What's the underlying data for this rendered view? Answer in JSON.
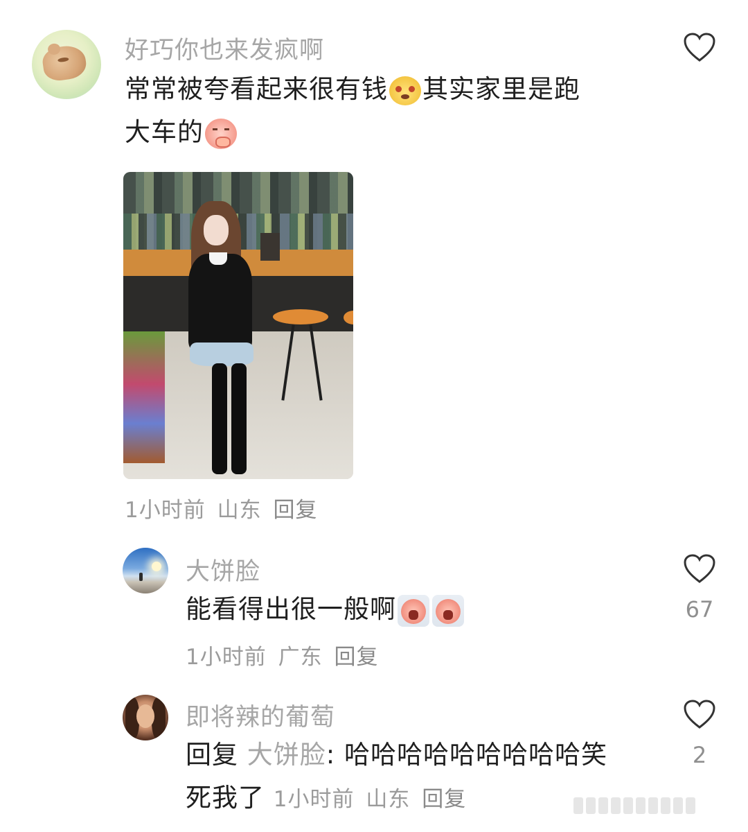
{
  "comment": {
    "username": "好巧你也来发疯啊",
    "text_line1_a": "常常被夸看起来很有钱",
    "text_line1_b": "其实家里是跑",
    "text_line2": "大车的",
    "emoji_1": "dog-face-emoji",
    "emoji_2": "sweet-face-emoji",
    "time": "1小时前",
    "location": "山东",
    "reply_label": "回复"
  },
  "replies": [
    {
      "username": "大饼脸",
      "text": "能看得出很一般啊",
      "emojis": [
        "crying-face-emoji",
        "crying-face-emoji"
      ],
      "time": "1小时前",
      "location": "广东",
      "reply_label": "回复",
      "likes": "67"
    },
    {
      "username": "即将辣的葡萄",
      "reply_prefix": "回复",
      "reply_to": "大饼脸",
      "text_a": ": 哈哈哈哈哈哈哈哈哈笑",
      "text_b": "死我了",
      "time": "1小时前",
      "location": "山东",
      "reply_label": "回复",
      "likes": "2"
    }
  ],
  "icons": {
    "like": "heart-outline-icon"
  },
  "colors": {
    "username": "#a6a6a6",
    "text": "#1f1f1f",
    "meta": "#9b9b9b"
  }
}
